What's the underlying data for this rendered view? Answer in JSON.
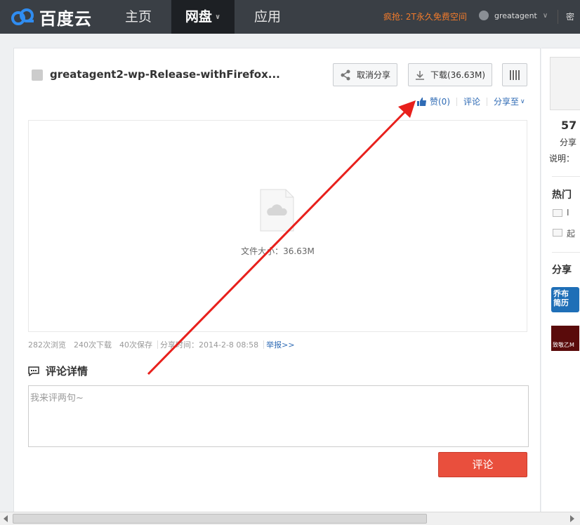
{
  "nav": {
    "logo_text": "百度云",
    "items": [
      {
        "label": "主页"
      },
      {
        "label": "网盘"
      },
      {
        "label": "应用"
      }
    ],
    "promo": "疯抢: 2T永久免费空间",
    "username": "greatagent",
    "right_cut": "密"
  },
  "file": {
    "title": "greatagent2-wp-Release-withFirefox...",
    "buttons": {
      "cancel_share": "取消分享",
      "download": "下载(36.63M)"
    },
    "actions": {
      "like": "赞(0)",
      "comment": "评论",
      "share_to": "分享至"
    },
    "size_label": "文件大小：36.63M",
    "stats": {
      "views": "282次浏览",
      "downloads": "240次下载",
      "saves": "40次保存",
      "share_time": "分享时间：2014-2-8 08:58",
      "report": "举报>>"
    }
  },
  "comments": {
    "heading": "评论详情",
    "placeholder": "我来评两句~",
    "submit": "评论"
  },
  "sidebar": {
    "num": "57",
    "line1": "分享",
    "line2": "说明：",
    "hot_heading": "热门",
    "hot_items": [
      "I",
      "起"
    ],
    "share_heading": "分享",
    "thumb1_text": "乔布 简历",
    "thumb2_text": "致敬乙M"
  },
  "colors": {
    "nav_bg": "#3a3f45",
    "accent_blue": "#2f6bb5",
    "promo_orange": "#f27b2b",
    "comment_button": "#e94f3d",
    "annotation_arrow": "#e8201c"
  }
}
